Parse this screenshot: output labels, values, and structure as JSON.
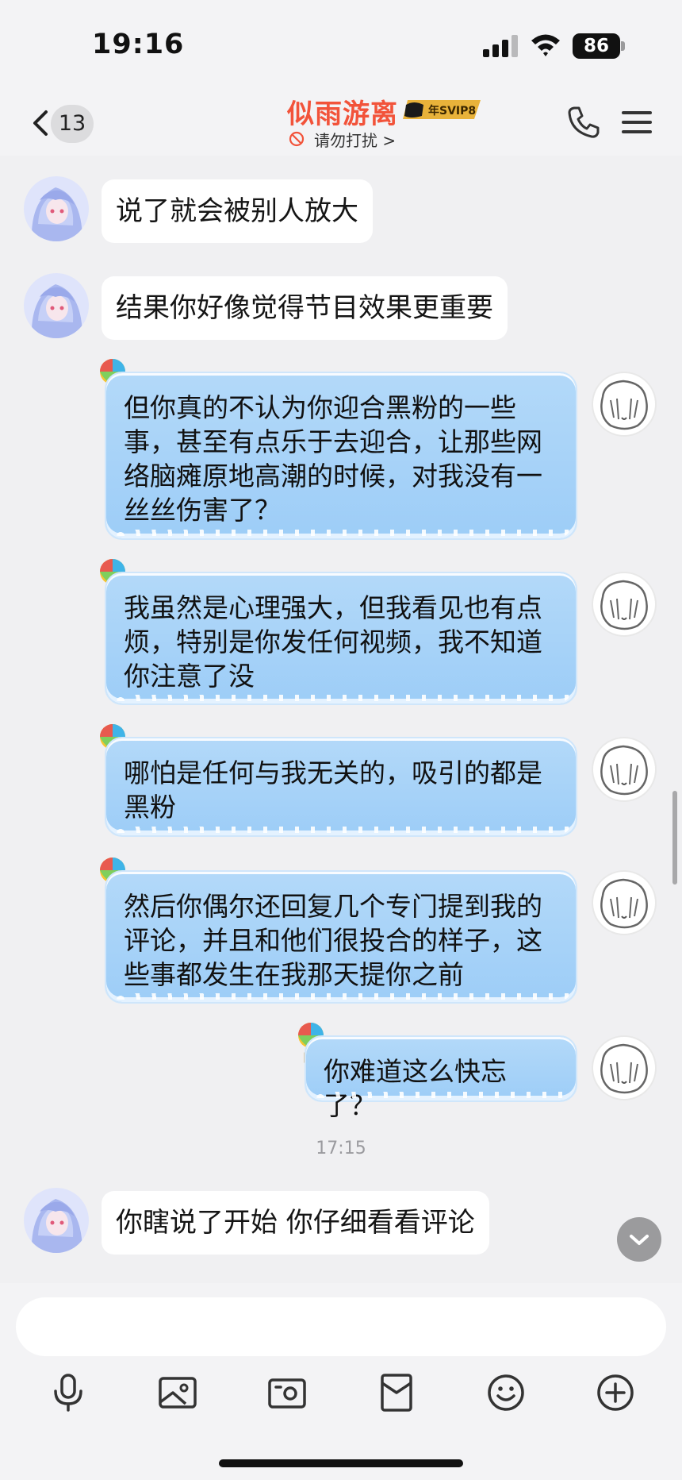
{
  "status_bar": {
    "time": "19:16",
    "battery": "86"
  },
  "header": {
    "unread_count": "13",
    "contact_name": "似雨游离",
    "vip_badge": "年SVIP8",
    "status_text": "请勿打扰 >"
  },
  "messages": [
    {
      "side": "left",
      "text": "说了就会被别人放大"
    },
    {
      "side": "left",
      "text": "结果你好像觉得节目效果更重要"
    },
    {
      "side": "right",
      "lines": [
        "但你真的不认为你迎合黑粉的一些",
        "事，甚至有点乐于去迎合，让那些网",
        "络脑瘫原地高潮的时候，对我没有一",
        "丝丝伤害了？"
      ]
    },
    {
      "side": "right",
      "lines": [
        "我虽然是心理强大，但我看见也有点",
        "烦，特别是你发任何视频，我不知道",
        "你注意了没"
      ]
    },
    {
      "side": "right",
      "lines": [
        "哪怕是任何与我无关的，吸引的都是",
        "黑粉"
      ]
    },
    {
      "side": "right",
      "lines": [
        "然后你偶尔还回复几个专门提到我的",
        "评论，并且和他们很投合的样子，这",
        "些事都发生在我那天提你之前"
      ]
    },
    {
      "side": "right",
      "lines": [
        "你难道这么快忘了？"
      ]
    },
    {
      "side": "left",
      "text": "你瞎说了开始 你仔细看看评论"
    }
  ],
  "timestamp": "17:15",
  "colors": {
    "contact_name": "#f2533a",
    "bubble_right": "#a8d3f8",
    "bubble_left": "#ffffff",
    "background": "#f0f0f2"
  },
  "toolbar_icons": [
    "microphone-icon",
    "image-icon",
    "camera-icon",
    "red-packet-icon",
    "emoji-icon",
    "plus-icon"
  ]
}
